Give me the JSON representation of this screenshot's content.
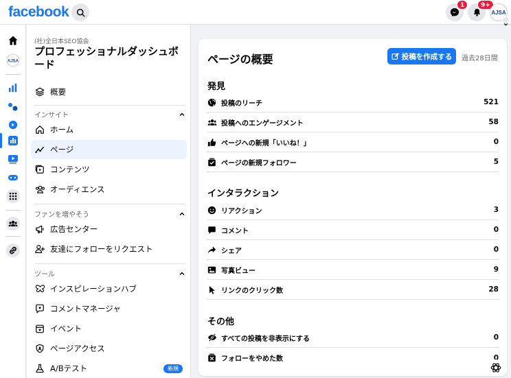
{
  "brand": {
    "logo": "facebook",
    "color": "#1877f2"
  },
  "topbar": {
    "messenger_badge": "1",
    "notifications_badge": "9+",
    "avatar_text": "AJSA"
  },
  "sidebar": {
    "org_name": "(社)全日本SEO協会",
    "title": "プロフェッショナルダッシュボード",
    "overview": "概要",
    "sections": [
      {
        "label": "インサイト",
        "items": [
          "ホーム",
          "ページ",
          "コンテンツ",
          "オーディエンス"
        ]
      },
      {
        "label": "ファンを増やそう",
        "items": [
          "広告センター",
          "友達にフォローをリクエスト"
        ]
      },
      {
        "label": "ツール",
        "items": [
          "インスピレーションハブ",
          "コメントマネージャ",
          "イベント",
          "ページアクセス",
          "A/Bテスト"
        ]
      }
    ],
    "new_badge": "新規",
    "active_item": "ページ"
  },
  "main": {
    "title": "ページの概要",
    "create_button": "投稿を作成する",
    "period": "過去28日間",
    "groups": [
      {
        "heading": "発見",
        "rows": [
          {
            "label": "投稿のリーチ",
            "value": "521",
            "icon": "globe-icon"
          },
          {
            "label": "投稿へのエンゲージメント",
            "value": "58",
            "icon": "people-icon"
          },
          {
            "label": "ページへの新規「いいね！」",
            "value": "0",
            "icon": "thumbs-up-icon"
          },
          {
            "label": "ページの新規フォロワー",
            "value": "5",
            "icon": "follow-check-icon"
          }
        ]
      },
      {
        "heading": "インタラクション",
        "rows": [
          {
            "label": "リアクション",
            "value": "3",
            "icon": "smiley-icon"
          },
          {
            "label": "コメント",
            "value": "0",
            "icon": "comment-icon"
          },
          {
            "label": "シェア",
            "value": "0",
            "icon": "share-icon"
          },
          {
            "label": "写真ビュー",
            "value": "9",
            "icon": "photo-icon"
          },
          {
            "label": "リンクのクリック数",
            "value": "28",
            "icon": "cursor-icon"
          }
        ]
      },
      {
        "heading": "その他",
        "rows": [
          {
            "label": "すべての投稿を非表示にする",
            "value": "0",
            "icon": "eye-slash-icon"
          },
          {
            "label": "フォローをやめた数",
            "value": "0",
            "icon": "unfollow-icon"
          }
        ]
      }
    ]
  }
}
